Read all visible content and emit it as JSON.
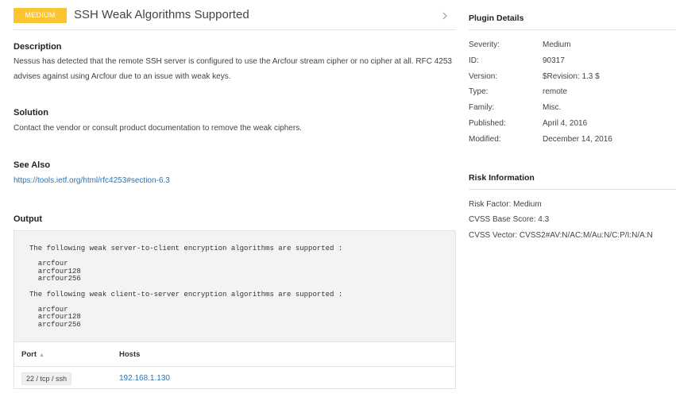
{
  "header": {
    "severity_badge": "MEDIUM",
    "title": "SSH Weak Algorithms Supported",
    "badge_color": "#fdc431"
  },
  "description": {
    "heading": "Description",
    "text": "Nessus has detected that the remote SSH server is configured to use the Arcfour stream cipher or no cipher at all. RFC 4253 advises against using Arcfour due to an issue with weak keys."
  },
  "solution": {
    "heading": "Solution",
    "text": "Contact the vendor or consult product documentation to remove the weak ciphers."
  },
  "see_also": {
    "heading": "See Also",
    "link": "https://tools.ietf.org/html/rfc4253#section-6.3"
  },
  "output": {
    "heading": "Output",
    "text": "The following weak server-to-client encryption algorithms are supported :\n\n  arcfour\n  arcfour128\n  arcfour256\n\nThe following weak client-to-server encryption algorithms are supported :\n\n  arcfour\n  arcfour128\n  arcfour256",
    "columns": {
      "port": "Port",
      "hosts": "Hosts"
    },
    "rows": [
      {
        "port": "22 / tcp / ssh",
        "host": "192.168.1.130"
      }
    ]
  },
  "plugin_details": {
    "heading": "Plugin Details",
    "rows": [
      {
        "label": "Severity:",
        "value": "Medium"
      },
      {
        "label": "ID:",
        "value": "90317"
      },
      {
        "label": "Version:",
        "value": "$Revision: 1.3 $"
      },
      {
        "label": "Type:",
        "value": "remote"
      },
      {
        "label": "Family:",
        "value": "Misc."
      },
      {
        "label": "Published:",
        "value": "April 4, 2016"
      },
      {
        "label": "Modified:",
        "value": "December 14, 2016"
      }
    ]
  },
  "risk_information": {
    "heading": "Risk Information",
    "risk_factor": "Risk Factor: Medium",
    "cvss_base_score": "CVSS Base Score: 4.3",
    "cvss_vector": "CVSS Vector: CVSS2#AV:N/AC:M/Au:N/C:P/I:N/A:N"
  },
  "colors": {
    "link": "#2a74b5",
    "output_bg": "#f3f3f3"
  },
  "icons": {
    "next": "chevron-right-icon",
    "sort": "sort-ascending-icon"
  }
}
